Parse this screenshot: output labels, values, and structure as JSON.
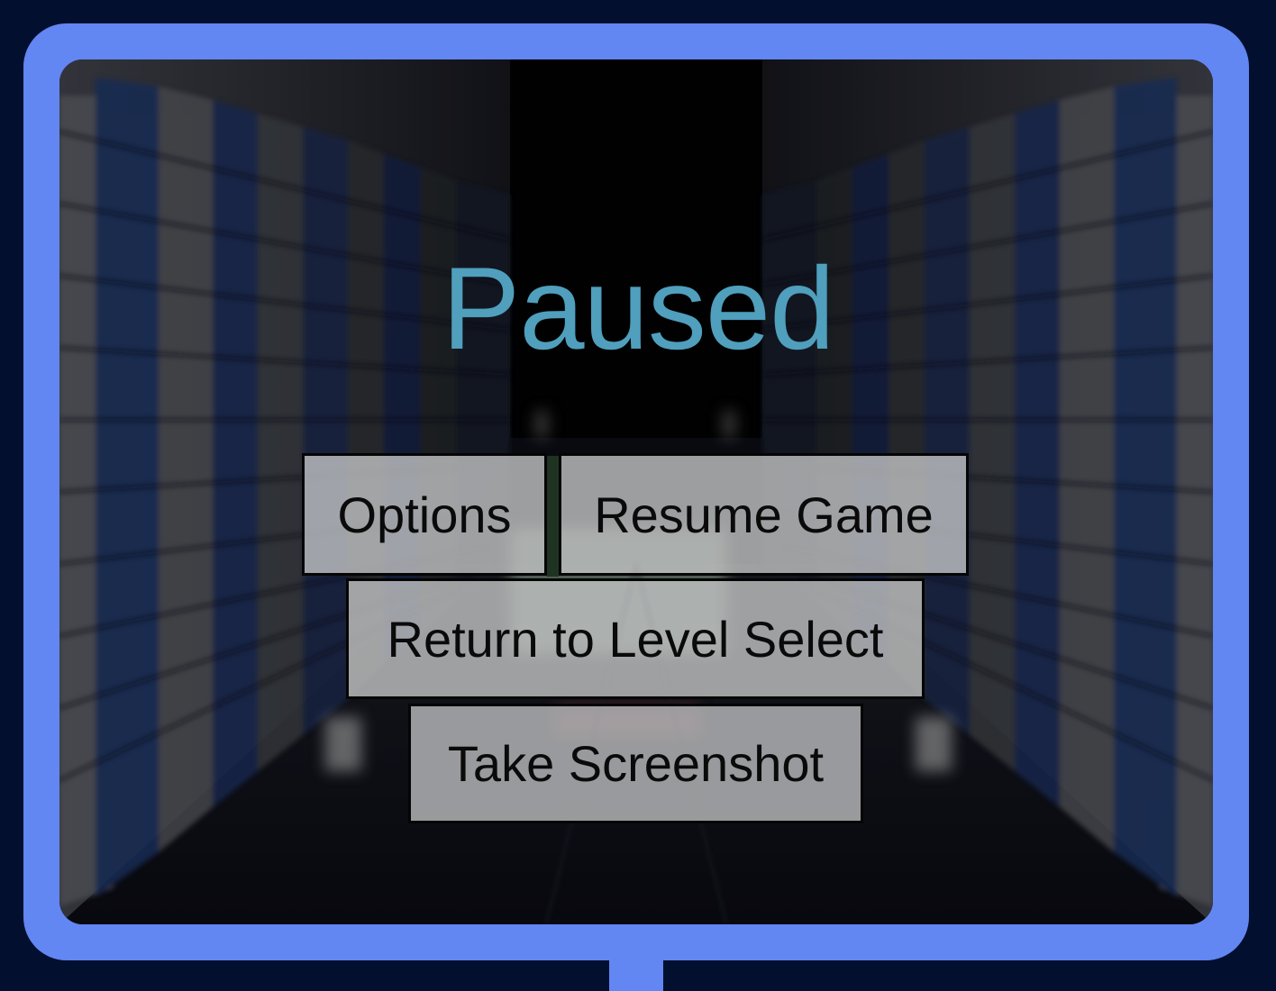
{
  "pause_menu": {
    "title": "Paused",
    "buttons": {
      "options": "Options",
      "resume": "Resume Game",
      "return_to_level_select": "Return to Level Select",
      "take_screenshot": "Take Screenshot"
    }
  },
  "colors": {
    "frame": "#6286f2",
    "page_background": "#030f2e",
    "title": "#4f9fbd",
    "button_fill": "#c6c8c8",
    "button_border": "#050505"
  }
}
